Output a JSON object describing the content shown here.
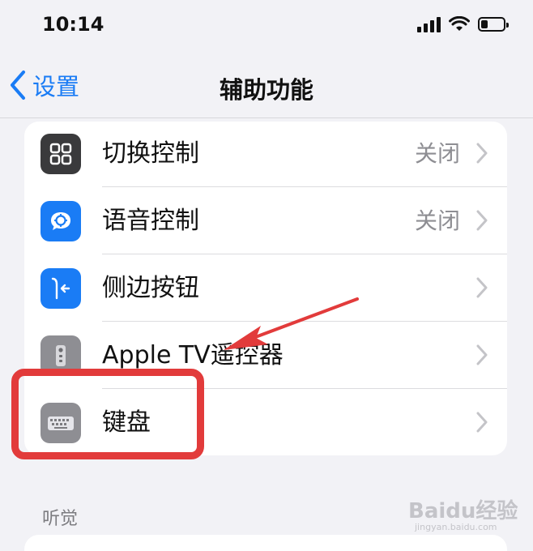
{
  "status_bar": {
    "time": "10:14",
    "battery_level": 0.3
  },
  "nav": {
    "back_label": "设置",
    "title": "辅助功能"
  },
  "rows": [
    {
      "label": "切换控制",
      "value": "关闭",
      "icon": "switch-control-icon",
      "icon_color": "#3a3a3c"
    },
    {
      "label": "语音控制",
      "value": "关闭",
      "icon": "voice-control-icon",
      "icon_color": "#1a7cf5"
    },
    {
      "label": "侧边按钮",
      "value": "",
      "icon": "side-button-icon",
      "icon_color": "#1a7cf5"
    },
    {
      "label": "Apple TV遥控器",
      "value": "",
      "icon": "apple-tv-remote-icon",
      "icon_color": "#8e8e93"
    },
    {
      "label": "键盘",
      "value": "",
      "icon": "keyboard-icon",
      "icon_color": "#8e8e93"
    }
  ],
  "section": {
    "header": "听觉"
  },
  "annotation": {
    "highlight_color": "#e23b3b"
  },
  "watermark": {
    "text": "Baidu经验",
    "sub": "jingyan.baidu.com"
  }
}
